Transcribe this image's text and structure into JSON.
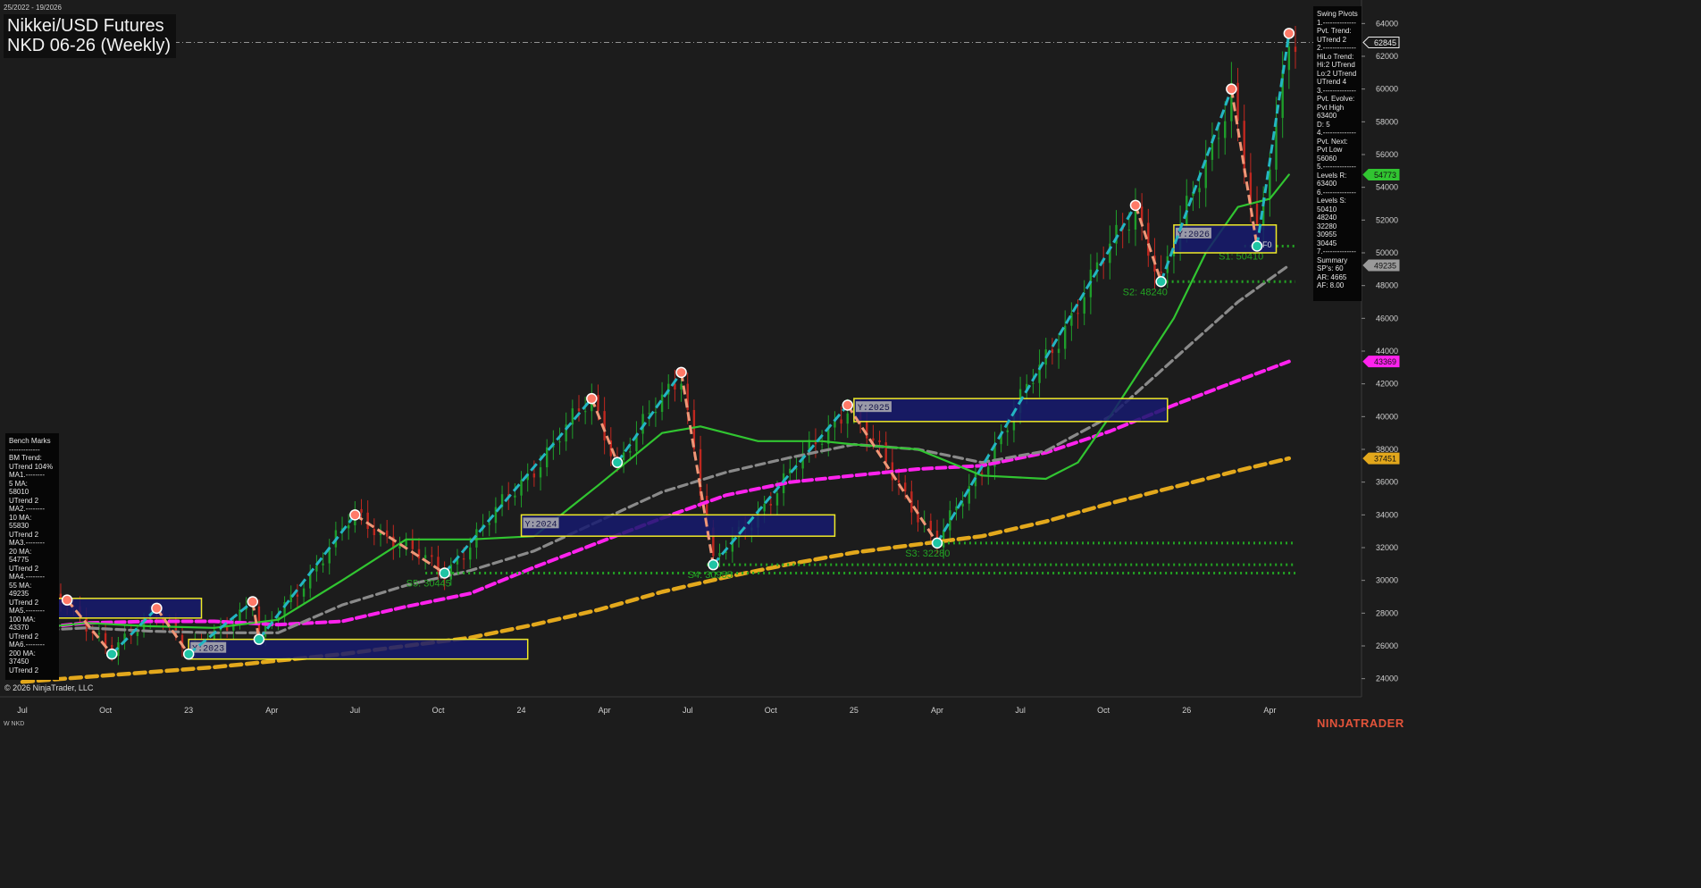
{
  "header": {
    "date_range": "25/2022 - 19/2026",
    "title": "Nikkei/USD Futures",
    "subtitle": "NKD 06-26 (Weekly)",
    "copyright": "© 2026 NinjaTrader, LLC",
    "symbol": "W NKD",
    "brand": "NINJATRADER"
  },
  "swing_pivots_panel": [
    "Swing Pivots",
    "1.--------------",
    "Pvt. Trend:",
    "UTrend 2",
    "2.--------------",
    "HiLo Trend:",
    "Hi:2 UTrend",
    "Lo:2 UTrend",
    "UTrend 4",
    "3.--------------",
    "Pvt. Evolve:",
    "Pvt High",
    "63400",
    "D: 5",
    "4.--------------",
    "Pvt. Next:",
    "Pvt Low",
    "56060",
    "5.--------------",
    "Levels R:",
    "63400",
    "6.--------------",
    "Levels S:",
    "50410",
    "48240",
    "32280",
    "30955",
    "30445",
    "7.--------------",
    "Summary",
    "SP's: 60",
    "AR: 4665",
    "AF: 8.00"
  ],
  "benchmarks_panel": [
    "Bench Marks",
    "-------------",
    "BM Trend:",
    "UTrend 104%",
    "MA1.--------",
    "5 MA:",
    "58010",
    "UTrend 2",
    "MA2.--------",
    "10 MA:",
    "55830",
    "UTrend 2",
    "MA3.--------",
    "20 MA:",
    "54775",
    "UTrend 2",
    "MA4.--------",
    "55 MA:",
    "49235",
    "UTrend 2",
    "MA5.--------",
    "100 MA:",
    "43370",
    "UTrend 2",
    "MA6.--------",
    "200 MA:",
    "37450",
    "UTrend 2"
  ],
  "colors": {
    "background": "#1c1c1c",
    "candle_up": "#1e9e2a",
    "candle_down": "#c0271f",
    "swing_up": "#23b5c2",
    "swing_down": "#f09777",
    "pivot_high": "#ff7a68",
    "pivot_low": "#1fc4a4",
    "ma20": "#31c531",
    "ma55": "#8a8a8a",
    "ma100": "#ff22ee",
    "ma200": "#e3a81c",
    "support": "#23a323",
    "year_box_fill": "#161a6e",
    "year_box_border": "#f0ea28"
  },
  "chart_data": {
    "type": "candlestick",
    "ylim": [
      23000,
      65000
    ],
    "y_ticks": [
      24000,
      26000,
      28000,
      30000,
      32000,
      34000,
      36000,
      38000,
      40000,
      42000,
      44000,
      46000,
      48000,
      50000,
      52000,
      54000,
      56000,
      58000,
      60000,
      62000,
      64000
    ],
    "x_labels": [
      "Jul",
      "Oct",
      "23",
      "Apr",
      "Jul",
      "Oct",
      "24",
      "Apr",
      "Jul",
      "Oct",
      "25",
      "Apr",
      "Jul",
      "Oct",
      "26",
      "Apr"
    ],
    "x_label_weeks": [
      0,
      13,
      26,
      39,
      52,
      65,
      78,
      91,
      104,
      117,
      130,
      143,
      156,
      169,
      182,
      195
    ],
    "price_markers": [
      {
        "label": "62845",
        "value": 62845,
        "color": "#ececec"
      },
      {
        "label": "54773",
        "value": 54773,
        "color": "#31c531"
      },
      {
        "label": "49235",
        "value": 49235,
        "color": "#9a9a9a"
      },
      {
        "label": "43369",
        "value": 43369,
        "color": "#ff22ee"
      },
      {
        "label": "37451",
        "value": 37451,
        "color": "#e3a81c"
      }
    ],
    "resistance_line": 62845,
    "swing_pivots": [
      {
        "w": 7,
        "v": 28800,
        "type": "H"
      },
      {
        "w": 14,
        "v": 25500,
        "type": "L"
      },
      {
        "w": 21,
        "v": 28300,
        "type": "H"
      },
      {
        "w": 26,
        "v": 25500,
        "type": "L"
      },
      {
        "w": 36,
        "v": 28700,
        "type": "H"
      },
      {
        "w": 37,
        "v": 26400,
        "type": "L"
      },
      {
        "w": 52,
        "v": 34000,
        "type": "H"
      },
      {
        "w": 66,
        "v": 30445,
        "type": "L"
      },
      {
        "w": 89,
        "v": 41100,
        "type": "H"
      },
      {
        "w": 93,
        "v": 37200,
        "type": "L"
      },
      {
        "w": 103,
        "v": 42700,
        "type": "H"
      },
      {
        "w": 108,
        "v": 30955,
        "type": "L"
      },
      {
        "w": 129,
        "v": 40700,
        "type": "H"
      },
      {
        "w": 143,
        "v": 32280,
        "type": "L"
      },
      {
        "w": 174,
        "v": 52900,
        "type": "H"
      },
      {
        "w": 178,
        "v": 48240,
        "type": "L"
      },
      {
        "w": 189,
        "v": 60000,
        "type": "H"
      },
      {
        "w": 193,
        "v": 50410,
        "type": "L"
      },
      {
        "w": 198,
        "v": 63400,
        "type": "H"
      }
    ],
    "ma20": [
      [
        0,
        27000
      ],
      [
        10,
        27400
      ],
      [
        20,
        27200
      ],
      [
        30,
        27100
      ],
      [
        40,
        27600
      ],
      [
        50,
        30000
      ],
      [
        60,
        32500
      ],
      [
        70,
        32500
      ],
      [
        80,
        32700
      ],
      [
        90,
        35800
      ],
      [
        100,
        39000
      ],
      [
        106,
        39400
      ],
      [
        115,
        38500
      ],
      [
        125,
        38500
      ],
      [
        130,
        38300
      ],
      [
        140,
        38000
      ],
      [
        150,
        36400
      ],
      [
        160,
        36200
      ],
      [
        165,
        37200
      ],
      [
        170,
        40000
      ],
      [
        180,
        46000
      ],
      [
        185,
        50000
      ],
      [
        190,
        52800
      ],
      [
        195,
        53300
      ],
      [
        198,
        54773
      ]
    ],
    "ma55": [
      [
        0,
        26900
      ],
      [
        10,
        27100
      ],
      [
        20,
        26900
      ],
      [
        30,
        26800
      ],
      [
        40,
        26800
      ],
      [
        50,
        28500
      ],
      [
        60,
        29700
      ],
      [
        70,
        30600
      ],
      [
        80,
        31800
      ],
      [
        90,
        33600
      ],
      [
        100,
        35400
      ],
      [
        110,
        36600
      ],
      [
        120,
        37500
      ],
      [
        130,
        38300
      ],
      [
        140,
        38000
      ],
      [
        150,
        37200
      ],
      [
        160,
        37900
      ],
      [
        170,
        40000
      ],
      [
        180,
        43500
      ],
      [
        190,
        47000
      ],
      [
        198,
        49235
      ]
    ],
    "ma100": [
      [
        0,
        27000
      ],
      [
        10,
        27400
      ],
      [
        20,
        27500
      ],
      [
        30,
        27500
      ],
      [
        40,
        27300
      ],
      [
        50,
        27500
      ],
      [
        60,
        28400
      ],
      [
        70,
        29200
      ],
      [
        80,
        30800
      ],
      [
        90,
        32300
      ],
      [
        100,
        33800
      ],
      [
        110,
        35200
      ],
      [
        120,
        36000
      ],
      [
        130,
        36400
      ],
      [
        140,
        36800
      ],
      [
        150,
        37000
      ],
      [
        160,
        37800
      ],
      [
        170,
        39100
      ],
      [
        180,
        40700
      ],
      [
        190,
        42200
      ],
      [
        198,
        43369
      ]
    ],
    "ma200": [
      [
        0,
        23800
      ],
      [
        10,
        24100
      ],
      [
        20,
        24400
      ],
      [
        30,
        24700
      ],
      [
        40,
        25100
      ],
      [
        50,
        25500
      ],
      [
        60,
        26000
      ],
      [
        70,
        26500
      ],
      [
        80,
        27300
      ],
      [
        90,
        28200
      ],
      [
        100,
        29300
      ],
      [
        110,
        30200
      ],
      [
        120,
        31000
      ],
      [
        130,
        31700
      ],
      [
        140,
        32200
      ],
      [
        150,
        32700
      ],
      [
        160,
        33600
      ],
      [
        170,
        34700
      ],
      [
        180,
        35700
      ],
      [
        190,
        36700
      ],
      [
        198,
        37451
      ]
    ],
    "support_lines": [
      {
        "label": "S1: 50410",
        "value": 50410,
        "from_w": 191,
        "to_w": 199,
        "label_w": 187
      },
      {
        "label": "S2: 48240",
        "value": 48240,
        "from_w": 178,
        "to_w": 199,
        "label_w": 172
      },
      {
        "label": "S3: 32280",
        "value": 32280,
        "from_w": 143,
        "to_w": 199,
        "label_w": 138
      },
      {
        "label": "S4: 30955",
        "value": 30955,
        "from_w": 107,
        "to_w": 199,
        "label_w": 104
      },
      {
        "label": "S5: 30445",
        "value": 30445,
        "from_w": 63,
        "to_w": 199,
        "label_w": 60
      }
    ],
    "year_boxes": [
      {
        "label": "Y:2023",
        "w0": 26,
        "w1": 79,
        "v0": 25200,
        "v1": 26400
      },
      {
        "label": "Y:2024",
        "w0": 78,
        "w1": 127,
        "v0": 32700,
        "v1": 34000
      },
      {
        "label": "Y:2025",
        "w0": 130,
        "w1": 179,
        "v0": 39700,
        "v1": 41100
      },
      {
        "label": "Y:2026",
        "w0": 180,
        "w1": 196,
        "v0": 50000,
        "v1": 51700
      },
      {
        "label": "",
        "w0": 0,
        "w1": 28,
        "v0": 27700,
        "v1": 28900
      }
    ],
    "f0_label": {
      "label": "F0",
      "w": 193,
      "v": 50500
    }
  }
}
